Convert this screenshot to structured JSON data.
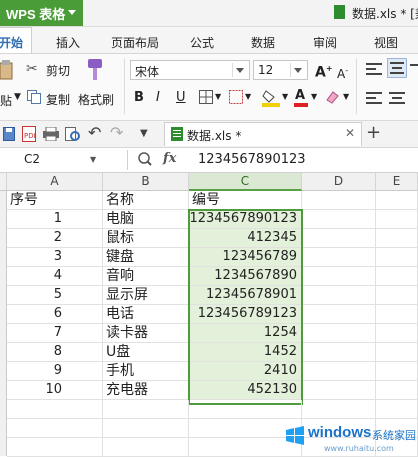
{
  "titlebar": {
    "app_name": "WPS 表格",
    "doc_title": "数据.xls * [兼"
  },
  "ribbon_tabs": [
    "开始",
    "插入",
    "页面布局",
    "公式",
    "数据",
    "审阅",
    "视图"
  ],
  "ribbon": {
    "cut": "剪切",
    "copy": "复制",
    "format_painter": "格式刷",
    "paste_partial": "贴",
    "font_name": "宋体",
    "font_size": "12",
    "bold": "B",
    "italic": "I",
    "underline": "U"
  },
  "quick_access": {
    "file_tab": "数据.xls *"
  },
  "formula_bar": {
    "name_box": "C2",
    "fx": "fx",
    "value": "1234567890123"
  },
  "columns": [
    "A",
    "B",
    "C",
    "D",
    "E"
  ],
  "table": {
    "headers": [
      "序号",
      "名称",
      "编号"
    ],
    "rows": [
      [
        "1",
        "电脑",
        "1234567890123"
      ],
      [
        "2",
        "鼠标",
        "412345"
      ],
      [
        "3",
        "键盘",
        "123456789"
      ],
      [
        "4",
        "音响",
        "1234567890"
      ],
      [
        "5",
        "显示屏",
        "12345678901"
      ],
      [
        "6",
        "电话",
        "123456789123"
      ],
      [
        "7",
        "读卡器",
        "1254"
      ],
      [
        "8",
        "U盘",
        "1452"
      ],
      [
        "9",
        "手机",
        "2410"
      ],
      [
        "10",
        "充电器",
        "452130"
      ]
    ]
  },
  "watermark": {
    "brand": "windows",
    "site": "系统家园",
    "url": "www.ruhaitu.com"
  },
  "colors": {
    "wps_green": "#4a9c39",
    "selection_green": "#4f9a3c",
    "selection_fill": "#e3f0da"
  }
}
